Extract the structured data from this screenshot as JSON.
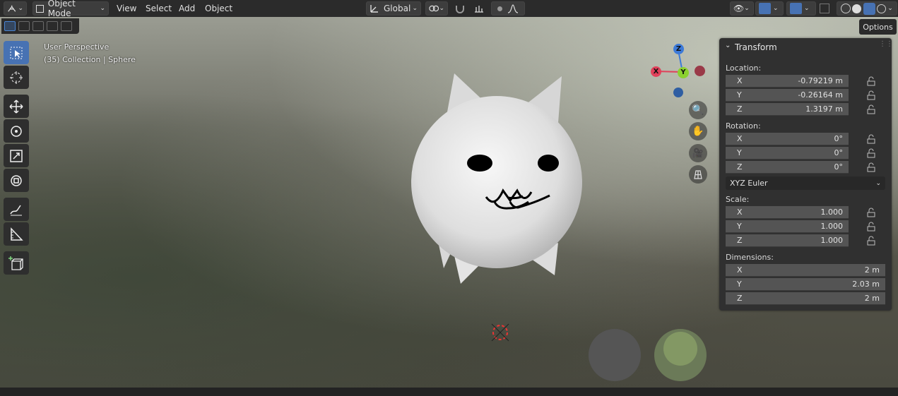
{
  "header": {
    "mode": "Object Mode",
    "menus": [
      "View",
      "Select",
      "Add",
      "Object"
    ],
    "orientation": "Global",
    "options_label": "Options"
  },
  "viewport": {
    "perspective": "User Perspective",
    "collection": "(35) Collection | Sphere"
  },
  "gizmo": {
    "x": "X",
    "y": "Y",
    "z": "Z"
  },
  "transform": {
    "title": "Transform",
    "location_label": "Location:",
    "location": [
      {
        "axis": "X",
        "value": "-0.79219 m"
      },
      {
        "axis": "Y",
        "value": "-0.26164 m"
      },
      {
        "axis": "Z",
        "value": "1.3197 m"
      }
    ],
    "rotation_label": "Rotation:",
    "rotation": [
      {
        "axis": "X",
        "value": "0°"
      },
      {
        "axis": "Y",
        "value": "0°"
      },
      {
        "axis": "Z",
        "value": "0°"
      }
    ],
    "rotation_mode": "XYZ Euler",
    "scale_label": "Scale:",
    "scale": [
      {
        "axis": "X",
        "value": "1.000"
      },
      {
        "axis": "Y",
        "value": "1.000"
      },
      {
        "axis": "Z",
        "value": "1.000"
      }
    ],
    "dimensions_label": "Dimensions:",
    "dimensions": [
      {
        "axis": "X",
        "value": "2 m"
      },
      {
        "axis": "Y",
        "value": "2.03 m"
      },
      {
        "axis": "Z",
        "value": "2 m"
      }
    ]
  },
  "colors": {
    "accent": "#4772b3",
    "axis_x": "#e0415a",
    "axis_y": "#8bd12f",
    "axis_z": "#3d7ad8"
  }
}
